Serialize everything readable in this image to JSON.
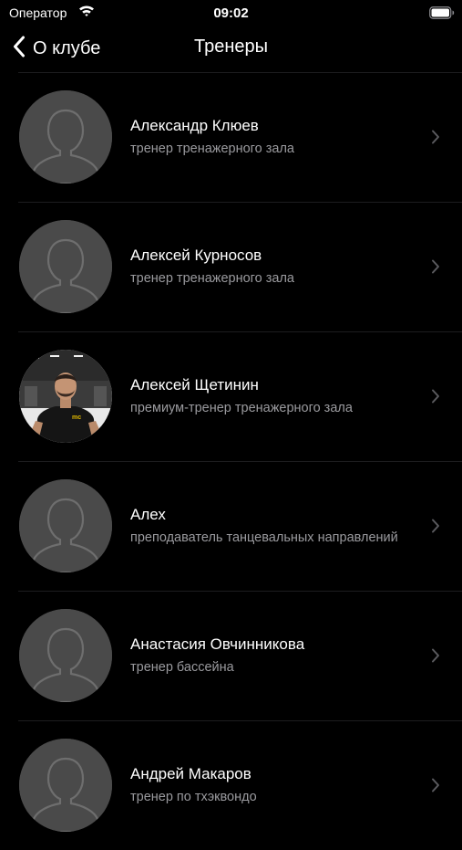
{
  "status_bar": {
    "carrier": "Оператор",
    "time": "09:02"
  },
  "nav": {
    "back_label": "О клубе",
    "title": "Тренеры"
  },
  "trainers": [
    {
      "name": "Александр Клюев",
      "role": "тренер тренажерного зала",
      "photo": false
    },
    {
      "name": "Алексей Курносов",
      "role": "тренер тренажерного зала",
      "photo": false
    },
    {
      "name": "Алексей Щетинин",
      "role": "премиум-тренер тренажерного зала",
      "photo": true
    },
    {
      "name": "Алех",
      "role": "преподаватель танцевальных направлений",
      "photo": false
    },
    {
      "name": "Анастасия Овчинникова",
      "role": "тренер бассейна",
      "photo": false
    },
    {
      "name": "Андрей Макаров",
      "role": "тренер по тхэквондо",
      "photo": false
    }
  ],
  "colors": {
    "background": "#000000",
    "avatar_placeholder": "#4a4a4a",
    "silhouette": "#6e6e6e",
    "subtitle": "#9a9a9e",
    "separator": "#1d1d1f",
    "chevron": "#5a5a5e"
  },
  "icons": {
    "status": [
      "wifi-icon",
      "battery-icon"
    ],
    "nav": "chevron-left-icon",
    "row_avatar": "person-silhouette-icon",
    "row_disclosure": "chevron-right-icon"
  }
}
